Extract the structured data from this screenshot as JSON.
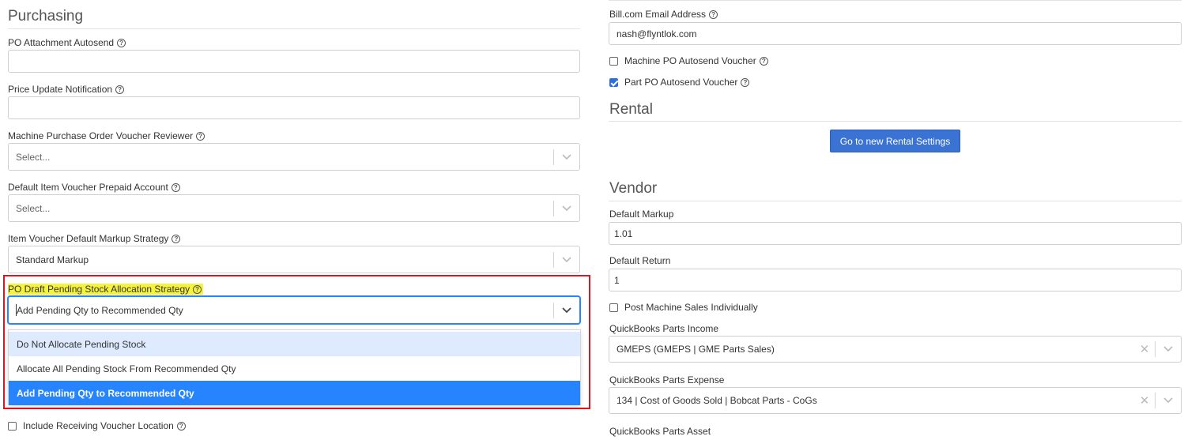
{
  "purchasing": {
    "title": "Purchasing",
    "po_attachment_autosend": {
      "label": "PO Attachment Autosend",
      "value": ""
    },
    "price_update_notification": {
      "label": "Price Update Notification",
      "value": ""
    },
    "machine_po_voucher_reviewer": {
      "label": "Machine Purchase Order Voucher Reviewer",
      "placeholder": "Select..."
    },
    "default_item_voucher_prepaid_account": {
      "label": "Default Item Voucher Prepaid Account",
      "placeholder": "Select..."
    },
    "item_voucher_default_markup_strategy": {
      "label": "Item Voucher Default Markup Strategy",
      "value": "Standard Markup"
    },
    "po_draft_pending_stock_allocation_strategy": {
      "label": "PO Draft Pending Stock Allocation Strategy",
      "value": "Add Pending Qty to Recommended Qty",
      "options": [
        "Do Not Allocate Pending Stock",
        "Allocate All Pending Stock From Recommended Qty",
        "Add Pending Qty to Recommended Qty"
      ]
    },
    "include_receiving_voucher_location": {
      "label": "Include Receiving Voucher Location",
      "checked": false
    }
  },
  "billcom": {
    "email_label": "Bill.com Email Address",
    "email_value": "nash@flyntlok.com",
    "machine_po_autosend_voucher": {
      "label": "Machine PO Autosend Voucher",
      "checked": false
    },
    "part_po_autosend_voucher": {
      "label": "Part PO Autosend Voucher",
      "checked": true
    }
  },
  "rental": {
    "title": "Rental",
    "button_label": "Go to new Rental Settings"
  },
  "vendor": {
    "title": "Vendor",
    "default_markup": {
      "label": "Default Markup",
      "value": "1.01"
    },
    "default_return": {
      "label": "Default Return",
      "value": "1"
    },
    "post_machine_sales_individually": {
      "label": "Post Machine Sales Individually",
      "checked": false
    },
    "quickbooks_parts_income": {
      "label": "QuickBooks Parts Income",
      "value": "GMEPS (GMEPS | GME Parts Sales)"
    },
    "quickbooks_parts_expense": {
      "label": "QuickBooks Parts Expense",
      "value": "134 | Cost of Goods Sold | Bobcat Parts - CoGs"
    },
    "quickbooks_parts_asset": {
      "label": "QuickBooks Parts Asset"
    }
  },
  "colors": {
    "accent": "#2684ff",
    "button": "#3a73d3",
    "highlight_box": "#e0141e",
    "highlight_text": "#f6f43a"
  },
  "icons": {
    "help": "question-circle-icon",
    "chevron": "chevron-down-icon",
    "clear": "clear-x-icon",
    "checkbox_checked": "checkmark-icon"
  }
}
